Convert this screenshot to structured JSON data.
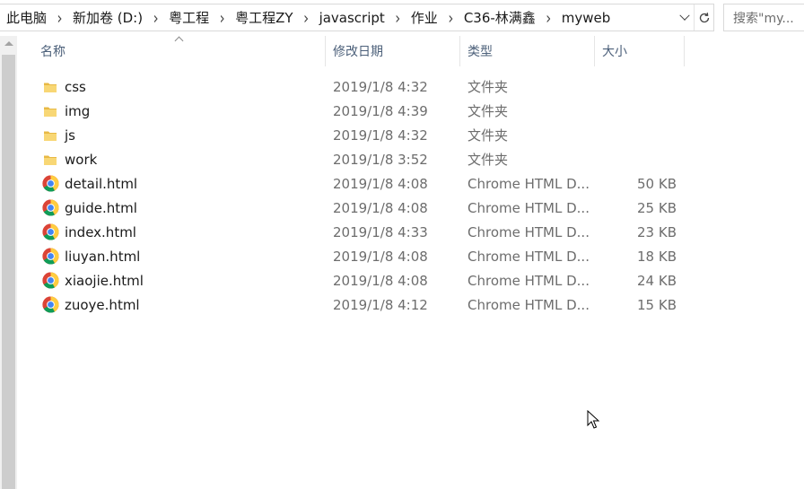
{
  "address_bar": {
    "breadcrumbs": [
      "此电脑",
      "新加卷 (D:)",
      "粤工程",
      "粤工程ZY",
      "javascript",
      "作业",
      "C36-林满鑫",
      "myweb"
    ],
    "dropdown_icon": "chevron-down-icon",
    "refresh_icon": "refresh-icon"
  },
  "search": {
    "placeholder": "搜索\"my..."
  },
  "columns": {
    "name": "名称",
    "date": "修改日期",
    "type": "类型",
    "size": "大小"
  },
  "files": [
    {
      "name": "css",
      "date": "2019/1/8 4:32",
      "type": "文件夹",
      "size": "",
      "icon": "folder-icon"
    },
    {
      "name": "img",
      "date": "2019/1/8 4:39",
      "type": "文件夹",
      "size": "",
      "icon": "folder-icon"
    },
    {
      "name": "js",
      "date": "2019/1/8 4:32",
      "type": "文件夹",
      "size": "",
      "icon": "folder-icon"
    },
    {
      "name": "work",
      "date": "2019/1/8 3:52",
      "type": "文件夹",
      "size": "",
      "icon": "folder-icon"
    },
    {
      "name": "detail.html",
      "date": "2019/1/8 4:08",
      "type": "Chrome HTML D...",
      "size": "50 KB",
      "icon": "chrome-icon"
    },
    {
      "name": "guide.html",
      "date": "2019/1/8 4:08",
      "type": "Chrome HTML D...",
      "size": "25 KB",
      "icon": "chrome-icon"
    },
    {
      "name": "index.html",
      "date": "2019/1/8 4:33",
      "type": "Chrome HTML D...",
      "size": "23 KB",
      "icon": "chrome-icon"
    },
    {
      "name": "liuyan.html",
      "date": "2019/1/8 4:08",
      "type": "Chrome HTML D...",
      "size": "18 KB",
      "icon": "chrome-icon"
    },
    {
      "name": "xiaojie.html",
      "date": "2019/1/8 4:08",
      "type": "Chrome HTML D...",
      "size": "24 KB",
      "icon": "chrome-icon"
    },
    {
      "name": "zuoye.html",
      "date": "2019/1/8 4:12",
      "type": "Chrome HTML D...",
      "size": "15 KB",
      "icon": "chrome-icon"
    }
  ],
  "colors": {
    "header_text": "#4c607a",
    "folder": "#f8d775",
    "scrollbar_track": "#f0f0f0",
    "scrollbar_thumb": "#cdcdcd"
  }
}
